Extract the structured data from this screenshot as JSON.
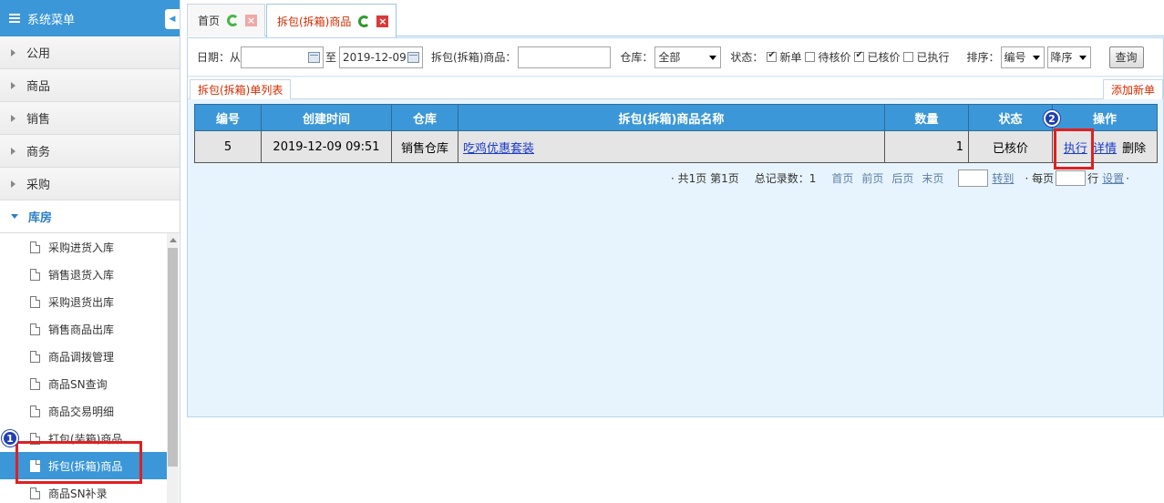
{
  "sidebar": {
    "title": "系统菜单",
    "collapse_icon": "chevron-left-icon",
    "groups": [
      {
        "label": "公用"
      },
      {
        "label": "商品"
      },
      {
        "label": "销售"
      },
      {
        "label": "商务"
      },
      {
        "label": "采购"
      },
      {
        "label": "库房"
      }
    ],
    "items": [
      {
        "label": "采购进货入库"
      },
      {
        "label": "销售退货入库"
      },
      {
        "label": "采购退货出库"
      },
      {
        "label": "销售商品出库"
      },
      {
        "label": "商品调拨管理"
      },
      {
        "label": "商品SN查询"
      },
      {
        "label": "商品交易明细"
      },
      {
        "label": "打包(装箱)商品"
      },
      {
        "label": "拆包(拆箱)商品"
      },
      {
        "label": "商品SN补录"
      }
    ]
  },
  "tabs": [
    {
      "label": "首页"
    },
    {
      "label": "拆包(拆箱)商品"
    }
  ],
  "filter": {
    "date_label": "日期：从",
    "date_from": "",
    "to_label": "至",
    "date_to": "2019-12-09",
    "product_label": "拆包(拆箱)商品：",
    "product_value": "",
    "warehouse_label": "仓库：",
    "warehouse_value": "全部",
    "status_label": "状态：",
    "status_options": [
      {
        "label": "新单",
        "checked": true
      },
      {
        "label": "待核价",
        "checked": false
      },
      {
        "label": "已核价",
        "checked": true
      },
      {
        "label": "已执行",
        "checked": false
      }
    ],
    "sort_label": "排序：",
    "sort_field": "编号",
    "sort_order": "降序",
    "query_button": "查询"
  },
  "list": {
    "tab_label": "拆包(拆箱)单列表",
    "add_new": "添加新单",
    "columns": [
      "编号",
      "创建时间",
      "仓库",
      "拆包(拆箱)商品名称",
      "数量",
      "状态",
      "操作"
    ],
    "rows": [
      {
        "id": "5",
        "created": "2019-12-09 09:51",
        "warehouse": "销售仓库",
        "product_name": "吃鸡优惠套装",
        "qty": "1",
        "status": "已核价",
        "actions": {
          "execute": "执行",
          "detail": "详情",
          "delete": "删除"
        }
      }
    ]
  },
  "pager": {
    "summary": "· 共1页 第1页",
    "total": "总记录数：1",
    "first": "首页",
    "prev": "前页",
    "next": "后页",
    "last": "末页",
    "goto": "转到",
    "per_page_label": "· 每页",
    "rows_label": "行",
    "settings": "设置",
    "tail": "·"
  },
  "annotations": {
    "badge_1": "1",
    "badge_2": "2",
    "mark_color": "#e02020"
  },
  "colors": {
    "accent": "#3b97d7",
    "active_tab_text": "#d42c00",
    "panel_bg": "#e8f4fd",
    "link": "#1a3acc"
  }
}
